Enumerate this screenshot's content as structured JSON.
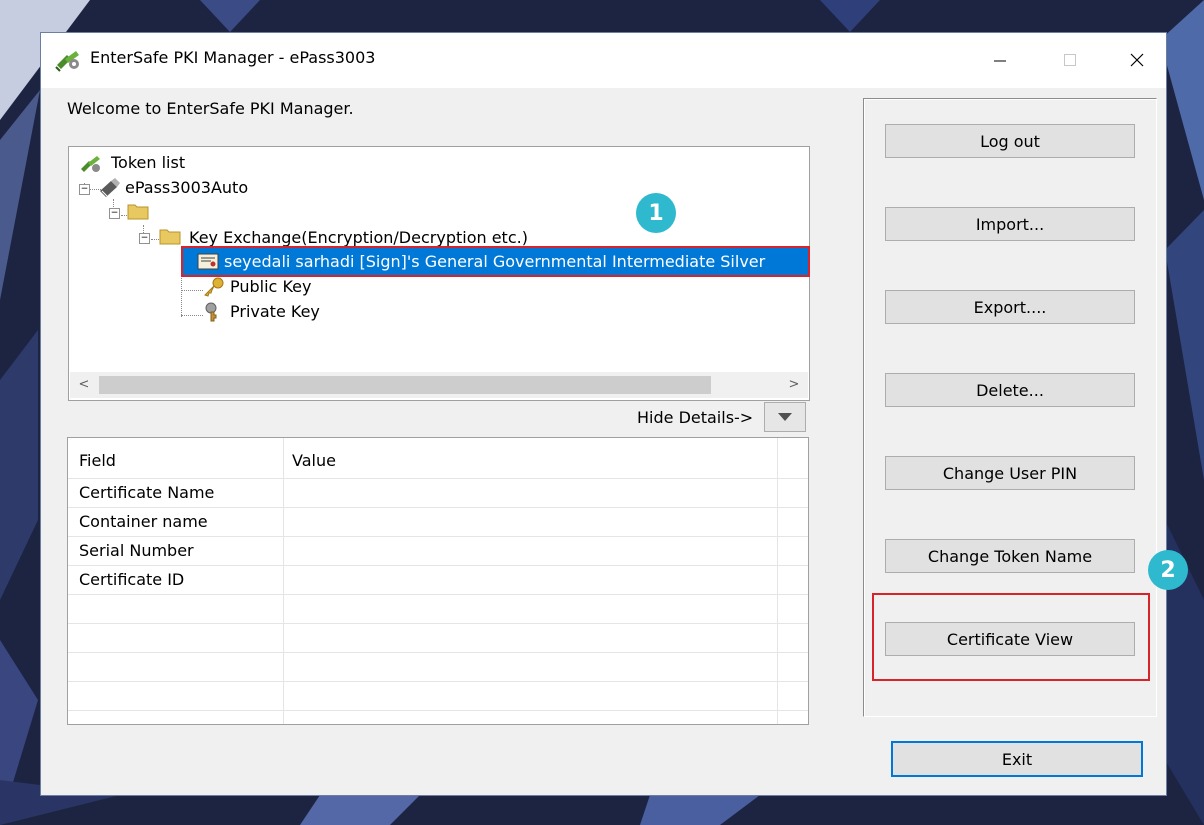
{
  "window": {
    "title": "EnterSafe PKI Manager - ePass3003",
    "welcome": "Welcome to EnterSafe PKI Manager."
  },
  "tree": {
    "root_label": "Token list",
    "token_label": "ePass3003Auto",
    "container_label": "Key Exchange(Encryption/Decryption etc.)",
    "certificate_label": "seyedali sarhadi [Sign]'s General Governmental Intermediate Silver",
    "public_key_label": "Public Key",
    "private_key_label": "Private Key"
  },
  "scroll": {
    "left": "<",
    "right": ">"
  },
  "details": {
    "toggle_label": "Hide Details->",
    "columns": [
      "Field",
      "Value"
    ],
    "fields": [
      "Certificate Name",
      "Container name",
      "Serial Number",
      "Certificate ID"
    ]
  },
  "buttons": {
    "logout": "Log out",
    "import": "Import...",
    "export": "Export....",
    "delete": "Delete...",
    "change_pin": "Change User PIN",
    "change_token_name": "Change Token Name",
    "certificate_view": "Certificate View",
    "exit": "Exit"
  },
  "annotations": {
    "step1": "1",
    "step2": "2"
  },
  "colors": {
    "selection": "#0078d7",
    "highlight_box": "#d8232a",
    "badge": "#2fb9cf"
  }
}
